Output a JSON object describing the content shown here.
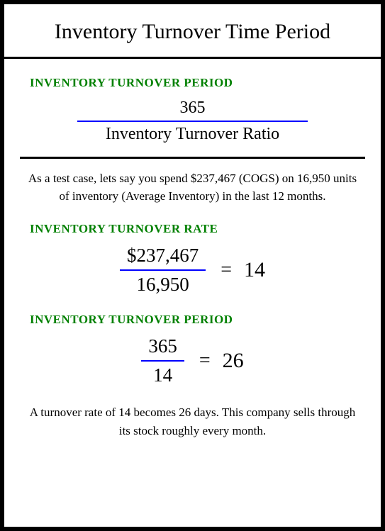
{
  "title": "Inventory Turnover Time Period",
  "sections": {
    "period_formula": {
      "heading": "INVENTORY TURNOVER PERIOD",
      "numerator": "365",
      "denominator": "Inventory Turnover Ratio"
    },
    "example_text": "As a test case, lets say you spend $237,467 (COGS) on 16,950 units of inventory (Average Inventory) in the last 12 months.",
    "rate_formula": {
      "heading": "INVENTORY TURNOVER RATE",
      "numerator": "$237,467",
      "denominator": "16,950",
      "equals": "=",
      "result": "14"
    },
    "period_example": {
      "heading": "INVENTORY TURNOVER PERIOD",
      "numerator": "365",
      "denominator": "14",
      "equals": "=",
      "result": "26"
    },
    "conclusion": "A turnover rate of 14 becomes 26 days. This company sells through its stock roughly every month."
  }
}
